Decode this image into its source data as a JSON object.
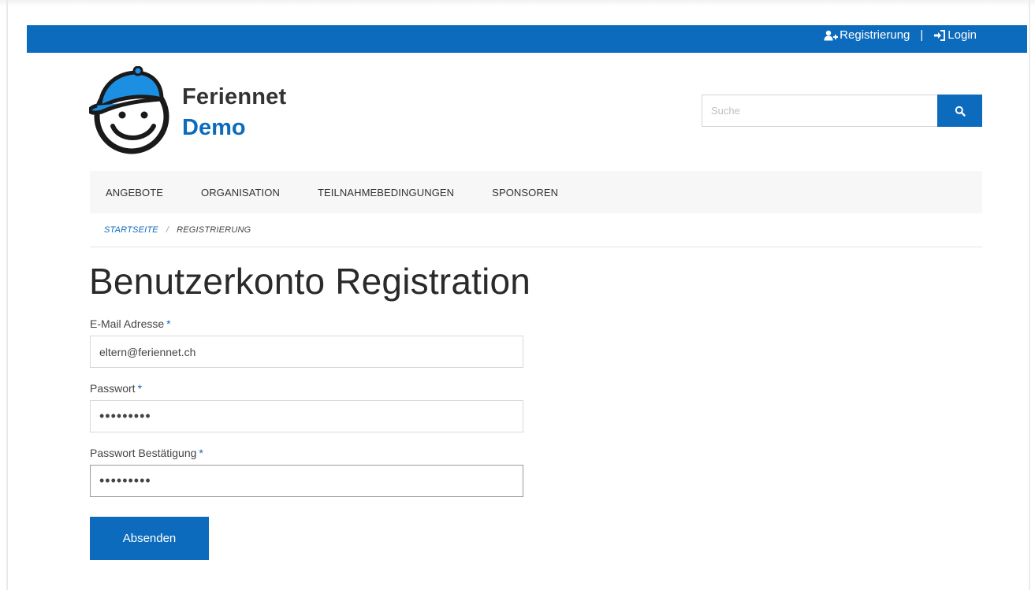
{
  "topbar": {
    "register_label": "Registrierung",
    "separator": "|",
    "login_label": "Login",
    "color": "#0d6bbd"
  },
  "brand": {
    "name_line1": "Feriennet",
    "name_line2": "Demo",
    "logo_icon": "smiley-cap-logo"
  },
  "search": {
    "placeholder": "Suche",
    "button_icon": "search-icon"
  },
  "nav": {
    "items": [
      {
        "label": "ANGEBOTE"
      },
      {
        "label": "ORGANISATION"
      },
      {
        "label": "TEILNAHMEBEDINGUNGEN"
      },
      {
        "label": "SPONSOREN"
      }
    ]
  },
  "breadcrumb": {
    "home": "STARTSEITE",
    "separator": "/",
    "current": "REGISTRIERUNG"
  },
  "page": {
    "title": "Benutzerkonto Registration"
  },
  "form": {
    "required_marker": "*",
    "email": {
      "label": "E-Mail Adresse",
      "value": "eltern@feriennet.ch"
    },
    "password": {
      "label": "Passwort",
      "value": "•••••••••"
    },
    "password_confirm": {
      "label": "Passwort Bestätigung",
      "value": "•••••••••"
    },
    "submit_label": "Absenden"
  }
}
